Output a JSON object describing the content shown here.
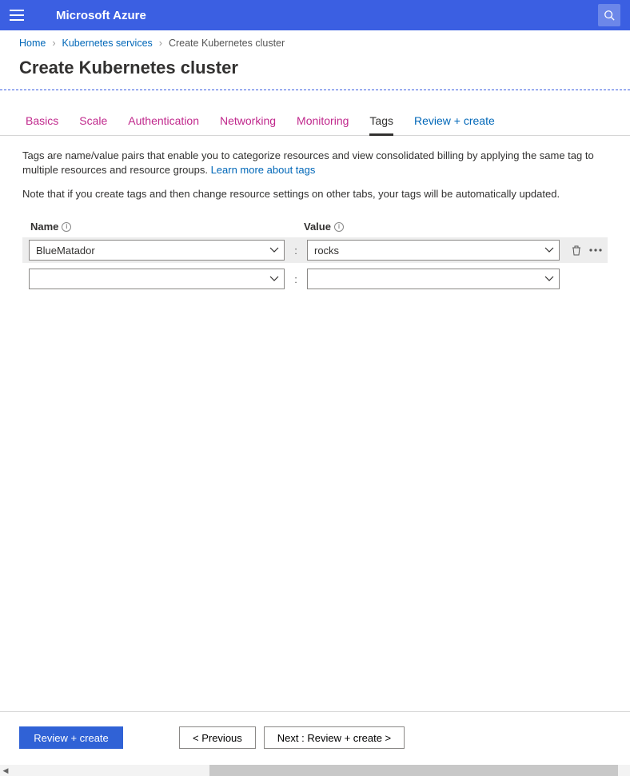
{
  "topbar": {
    "brand": "Microsoft Azure"
  },
  "breadcrumbs": {
    "items": [
      "Home",
      "Kubernetes services",
      "Create Kubernetes cluster"
    ]
  },
  "page": {
    "title": "Create Kubernetes cluster"
  },
  "tabs": {
    "items": [
      {
        "label": "Basics"
      },
      {
        "label": "Scale"
      },
      {
        "label": "Authentication"
      },
      {
        "label": "Networking"
      },
      {
        "label": "Monitoring"
      },
      {
        "label": "Tags",
        "active": true
      },
      {
        "label": "Review + create",
        "review": true
      }
    ]
  },
  "content": {
    "desc": "Tags are name/value pairs that enable you to categorize resources and view consolidated billing by applying the same tag to multiple resources and resource groups.  ",
    "learn_more": "Learn more about tags",
    "note": "Note that if you create tags and then change resource settings on other tabs, your tags will be automatically updated."
  },
  "table": {
    "name_header": "Name",
    "value_header": "Value",
    "rows": [
      {
        "name": "BlueMatador",
        "value": "rocks",
        "actions": true
      },
      {
        "name": "",
        "value": "",
        "actions": false
      }
    ]
  },
  "footer": {
    "primary": "Review + create",
    "prev": "< Previous",
    "next": "Next : Review + create >"
  }
}
